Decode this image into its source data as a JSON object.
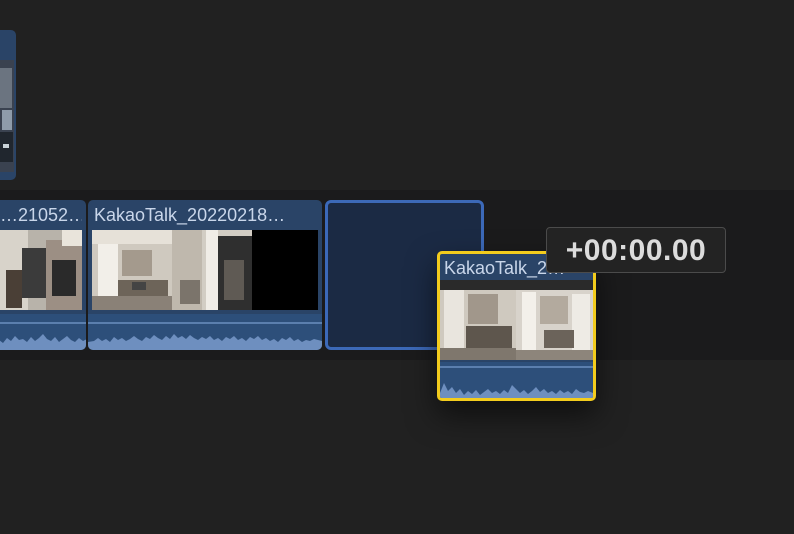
{
  "timeline": {
    "clips": [
      {
        "title": "",
        "kind": "connected-clip"
      },
      {
        "title": "…21052…",
        "kind": "primary-clip"
      },
      {
        "title": "KakaoTalk_20220218…",
        "kind": "primary-clip"
      }
    ],
    "gap": {
      "kind": "gap-placeholder"
    },
    "dragged_clip": {
      "title": "KakaoTalk_2…"
    },
    "timecode_readout": "+00:00.00"
  },
  "colors": {
    "background": "#212121",
    "clip_fill": "#2a4467",
    "selection_border": "#f3cc1d",
    "gap_border": "#3c69b8"
  }
}
